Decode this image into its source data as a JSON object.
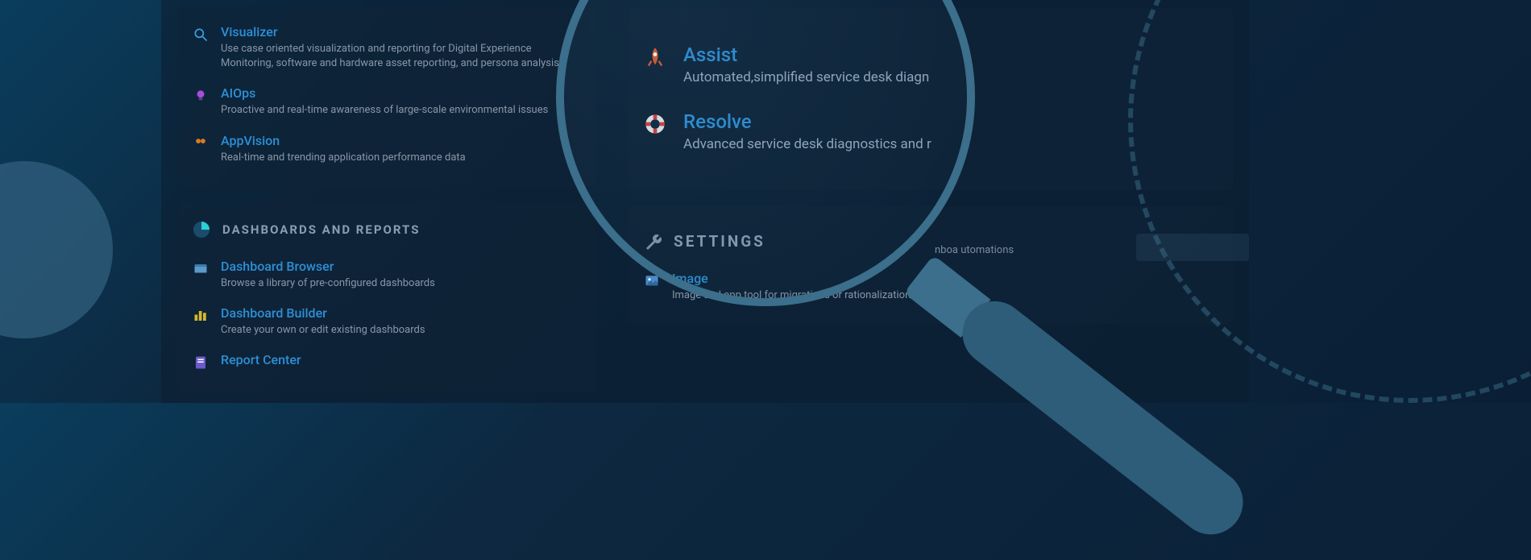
{
  "left": {
    "topItems": [
      {
        "title": "Visualizer",
        "desc": "Use case oriented visualization and reporting for Digital Experience Monitoring, software and hardware asset reporting, and persona analysis",
        "icon": "search-icon"
      },
      {
        "title": "AIOps",
        "desc": "Proactive and real-time awareness of large-scale environmental issues",
        "icon": "bulb-icon"
      },
      {
        "title": "AppVision",
        "desc": "Real-time and trending application performance data",
        "icon": "binoculars-icon"
      }
    ],
    "dashboards": {
      "header": "DASHBOARDS AND REPORTS",
      "items": [
        {
          "title": "Dashboard Browser",
          "desc": "Browse a library of pre-configured dashboards",
          "icon": "folder-icon"
        },
        {
          "title": "Dashboard Builder",
          "desc": "Create your own or edit existing dashboards",
          "icon": "chart-icon"
        },
        {
          "title": "Report Center",
          "desc": "",
          "icon": "report-icon"
        }
      ]
    }
  },
  "right": {
    "serviceDesk": [
      {
        "title": "Assist",
        "desc": "Automated,simplified service desk diagn",
        "icon": "rocket-icon"
      },
      {
        "title": "Resolve",
        "desc": "Advanced service desk diagnostics and r",
        "icon": "lifebuoy-icon"
      }
    ],
    "settings": {
      "header": "SETTINGS",
      "item": {
        "title": "Image",
        "desc": "Image and app                            tool for migrations or rationalization e",
        "icon": "image-icon"
      }
    },
    "hint": "nboa               utomations"
  }
}
